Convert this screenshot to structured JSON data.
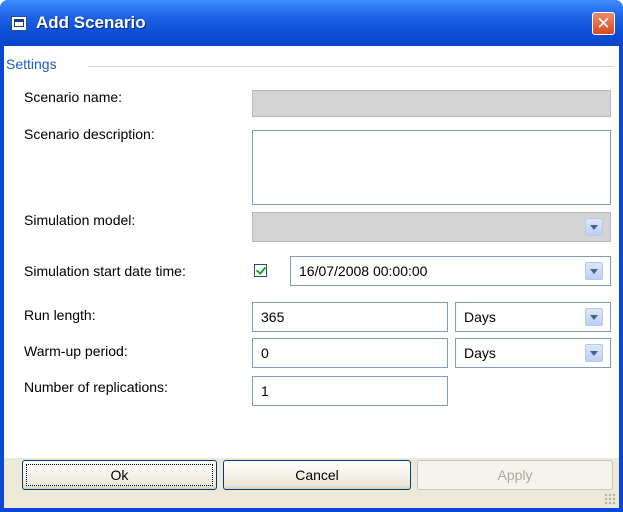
{
  "window": {
    "title": "Add Scenario"
  },
  "group": {
    "label": "Settings"
  },
  "fields": {
    "scenario_name": {
      "label": "Scenario name:",
      "value": ""
    },
    "scenario_description": {
      "label": "Scenario description:",
      "value": ""
    },
    "simulation_model": {
      "label": "Simulation model:",
      "value": ""
    },
    "start_datetime": {
      "label": "Simulation start date time:",
      "checked": true,
      "value": "16/07/2008 00:00:00"
    },
    "run_length": {
      "label": "Run length:",
      "value": "365",
      "unit": "Days"
    },
    "warmup": {
      "label": "Warm-up period:",
      "value": "0",
      "unit": "Days"
    },
    "replications": {
      "label": "Number of replications:",
      "value": "1"
    }
  },
  "buttons": {
    "ok": "Ok",
    "cancel": "Cancel",
    "apply": "Apply"
  },
  "icons": {
    "title": "window-app-icon",
    "close": "close-icon",
    "dropdown": "chevron-down-icon",
    "check": "checkmark-icon"
  },
  "colors": {
    "title_bar": "#0a47d6",
    "group_label": "#1e5bc6",
    "disabled_field": "#d4d4d4"
  }
}
